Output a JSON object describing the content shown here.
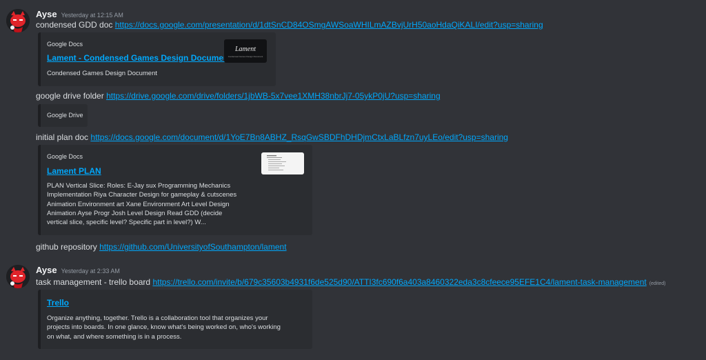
{
  "messages": [
    {
      "username": "Ayse",
      "timestamp": "Yesterday at 12:15 AM",
      "lines": [
        {
          "text": "condensed GDD doc",
          "url": "https://docs.google.com/presentation/d/1dtSnCD84OSmgAWSoaWHILmAZBvjUrH50aoHdaQiKALI/edit?usp=sharing"
        },
        {
          "text": "google drive folder",
          "url": "https://drive.google.com/drive/folders/1jbWB-5x7vee1XMH38nbrJj7-05ykP0jU?usp=sharing"
        },
        {
          "text": "initial plan doc",
          "url": "https://docs.google.com/document/d/1YoE7Bn8ABHZ_RsqGwSBDFhDHDjmCtxLaBLfzn7uyLEo/edit?usp=sharing"
        },
        {
          "text": "github repository",
          "url": "https://github.com/UniversityofSouthampton/lament"
        }
      ],
      "embeds": [
        {
          "provider": "Google Docs",
          "title": "Lament - Condensed Games Design Document",
          "description": "Condensed Games Design Document",
          "thumb_text": "Lament",
          "thumb_sub": "Condensed Games Design Document"
        },
        {
          "provider": "Google Drive"
        },
        {
          "provider": "Google Docs",
          "title": "Lament PLAN",
          "description_lines": [
            "PLAN Vertical Slice: Roles: E-Jay sux Programming Mechanics",
            "Implementation Riya Character Design for gameplay & cutscenes",
            "Animation Environment art Xane Environment Art Level Design",
            "Animation Ayse Progr Josh Level Design Read GDD (decide",
            "vertical slice, specific level? Specific part in level?) W..."
          ]
        }
      ]
    },
    {
      "username": "Ayse",
      "timestamp": "Yesterday at 2:33 AM",
      "lines": [
        {
          "text": "task management - trello board",
          "url": "https://trello.com/invite/b/679c35603b4931f6de525d90/ATTI3fc690f6a403a8460322eda3c8cfeece95EFE1C4/lament-task-management",
          "edited": "(edited)"
        }
      ],
      "embeds": [
        {
          "title": "Trello",
          "description_lines": [
            "Organize anything, together. Trello is a collaboration tool that organizes your",
            "projects into boards. In one glance, know what's being worked on, who's working",
            "on what, and where something is in a process."
          ]
        }
      ]
    }
  ]
}
